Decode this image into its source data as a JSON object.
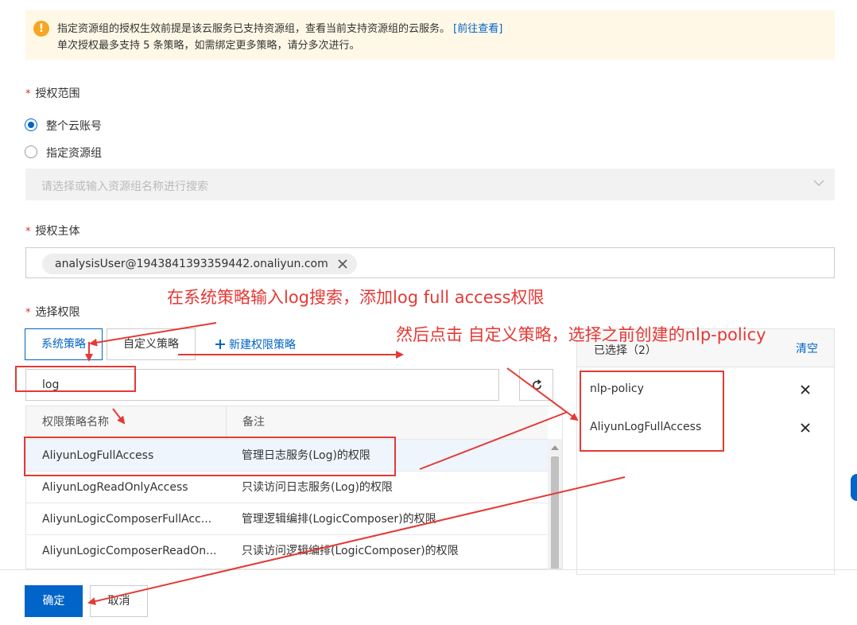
{
  "alert": {
    "line1": "指定资源组的授权生效前提是该云服务已支持资源组，查看当前支持资源组的云服务。",
    "link": "[前往查看]",
    "line2": "单次授权最多支持 5 条策略，如需绑定更多策略，请分多次进行。"
  },
  "scope": {
    "label": "授权范围",
    "options": [
      "整个云账号",
      "指定资源组"
    ],
    "selected": "整个云账号",
    "resource_group_placeholder": "请选择或输入资源组名称进行搜索"
  },
  "principal": {
    "label": "授权主体",
    "value": "analysisUser@1943841393359442.onaliyun.com"
  },
  "permissions": {
    "label": "选择权限",
    "tabs": [
      "系统策略",
      "自定义策略"
    ],
    "active_tab": "系统策略",
    "new_policy": "新建权限策略",
    "search_value": "log",
    "columns": [
      "权限策略名称",
      "备注"
    ],
    "rows": [
      {
        "name": "AliyunLogFullAccess",
        "note": "管理日志服务(Log)的权限"
      },
      {
        "name": "AliyunLogReadOnlyAccess",
        "note": "只读访问日志服务(Log)的权限"
      },
      {
        "name": "AliyunLogicComposerFullAcc...",
        "note": "管理逻辑编排(LogicComposer)的权限"
      },
      {
        "name": "AliyunLogicComposerReadOn...",
        "note": "只读访问逻辑编排(LogicComposer)的权限"
      }
    ]
  },
  "selected_panel": {
    "title": "已选择（2）",
    "clear": "清空",
    "items": [
      "nlp-policy",
      "AliyunLogFullAccess"
    ]
  },
  "footer": {
    "confirm": "确定",
    "cancel": "取消"
  },
  "annotations": {
    "note1": "在系统策略输入log搜索，添加log full access权限",
    "note2": "然后点击 自定义策略，选择之前创建的nlp-policy"
  },
  "colors": {
    "primary": "#0064c8",
    "annotation": "#e53935",
    "warning": "#f5a623"
  }
}
